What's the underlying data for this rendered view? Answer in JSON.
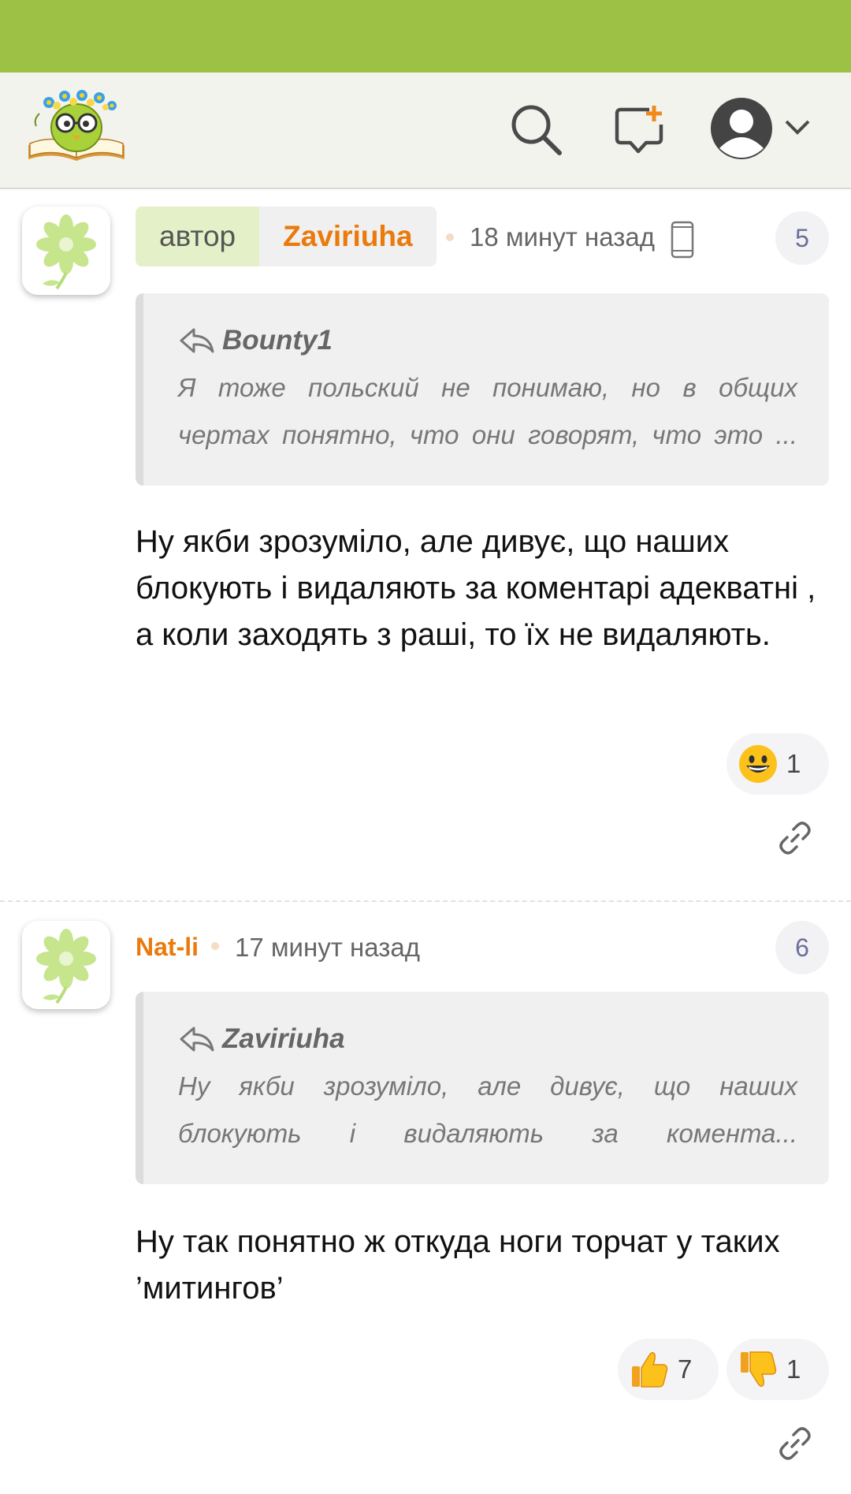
{
  "header": {
    "logo": "site-logo-owl-with-flowers",
    "search_icon": "search-icon",
    "new_post_icon": "new-comment-icon",
    "user_icon": "user-avatar-icon",
    "dropdown_icon": "chevron-down-icon"
  },
  "comments": [
    {
      "author_role": "автор",
      "author": "Zaviriuha",
      "time": "18 минут назад",
      "device_icon": "mobile-phone-icon",
      "number": "5",
      "quote": {
        "author": "Bounty1",
        "line1": "Я тоже польский не понимаю, но в общих",
        "line2": "чертах понятно, что они говорят, что это ..."
      },
      "text": "Ну якби зрозуміло, але дивує, що наших блокують і видаляють за коментарі адекватні , а коли заходять з раші, то їх не видаляють.",
      "reactions": [
        {
          "icon": "grinning-face-emoji",
          "count": "1"
        }
      ]
    },
    {
      "author": "Nat-li",
      "time": "17 минут назад",
      "number": "6",
      "quote": {
        "author": "Zaviriuha",
        "line1": "Ну якби зрозуміло, але дивує, що наших",
        "line2": "блокують і видаляють за комента..."
      },
      "text": "Ну так понятно ж откуда ноги торчат у таких ’митингов’",
      "reactions": [
        {
          "icon": "thumbs-up-emoji",
          "count": "7"
        },
        {
          "icon": "thumbs-down-emoji",
          "count": "1"
        }
      ]
    }
  ],
  "colors": {
    "statusbar": "#9dc145",
    "header_bg": "#f3f3ee",
    "author_accent": "#ea7a0c",
    "author_role_bg": "#e3f0c8"
  }
}
